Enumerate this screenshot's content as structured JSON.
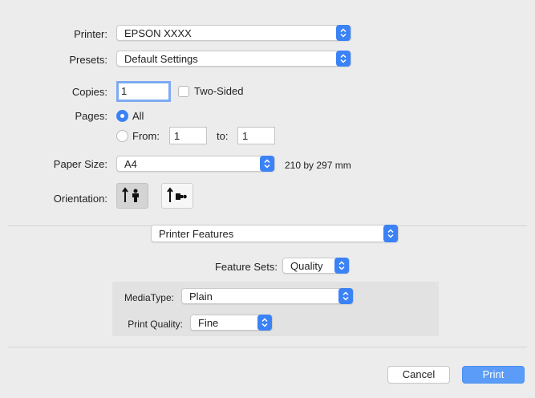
{
  "printer": {
    "label": "Printer:",
    "value": "EPSON XXXX"
  },
  "presets": {
    "label": "Presets:",
    "value": "Default Settings"
  },
  "copies": {
    "label": "Copies:",
    "value": "1",
    "two_sided_label": "Two-Sided",
    "two_sided_checked": false
  },
  "pages": {
    "label": "Pages:",
    "all_label": "All",
    "from_label": "From:",
    "from_value": "1",
    "to_label": "to:",
    "to_value": "1",
    "selected": "All"
  },
  "paper_size": {
    "label": "Paper Size:",
    "value": "A4",
    "dimensions": "210 by 297 mm"
  },
  "orientation": {
    "label": "Orientation:",
    "options": [
      "portrait",
      "landscape"
    ],
    "selected": "portrait"
  },
  "section": {
    "value": "Printer Features"
  },
  "feature_sets": {
    "label": "Feature Sets:",
    "value": "Quality"
  },
  "media_type": {
    "label": "MediaType:",
    "value": "Plain"
  },
  "print_quality": {
    "label": "Print Quality:",
    "value": "Fine"
  },
  "buttons": {
    "cancel": "Cancel",
    "print": "Print"
  },
  "colors": {
    "accent": "#3b82f6",
    "background": "#ececec",
    "panel": "#e3e3e3"
  }
}
